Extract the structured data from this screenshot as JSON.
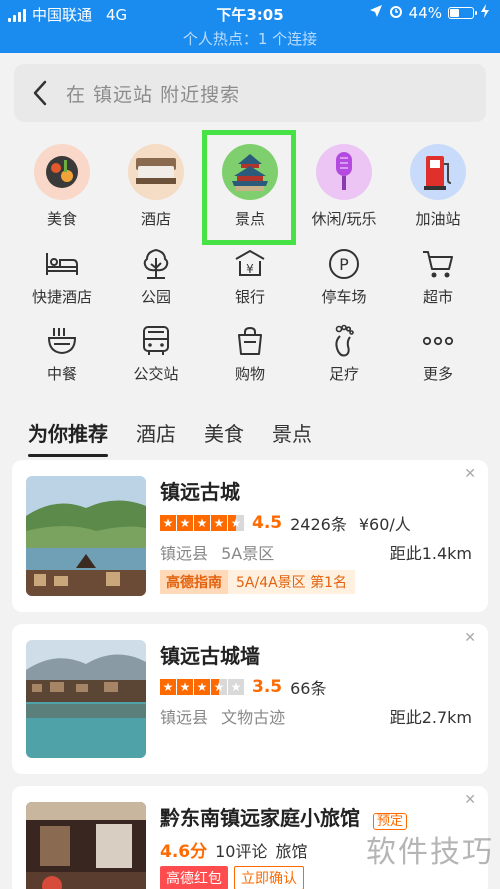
{
  "status": {
    "carrier": "中国联通",
    "network": "4G",
    "time": "下午3:05",
    "battery": "44%"
  },
  "hotspot": "个人热点：1 个连接",
  "search": {
    "placeholder": "在 镇远站 附近搜索"
  },
  "categories_top": [
    {
      "label": "美食",
      "icon": "food-icon",
      "color": "#f9d7c9"
    },
    {
      "label": "酒店",
      "icon": "hotel-bed-icon",
      "color": "#f5dcc5"
    },
    {
      "label": "景点",
      "icon": "temple-icon",
      "color": "#7fcf6e"
    },
    {
      "label": "休闲/玩乐",
      "icon": "microphone-icon",
      "color": "#ecc5f5"
    },
    {
      "label": "加油站",
      "icon": "gas-station-icon",
      "color": "#c9dbfa"
    }
  ],
  "categories_mid": [
    {
      "label": "快捷酒店",
      "icon": "bed-icon"
    },
    {
      "label": "公园",
      "icon": "tree-icon"
    },
    {
      "label": "银行",
      "icon": "bank-icon"
    },
    {
      "label": "停车场",
      "icon": "parking-icon"
    },
    {
      "label": "超市",
      "icon": "cart-icon"
    }
  ],
  "categories_bottom": [
    {
      "label": "中餐",
      "icon": "bowl-icon"
    },
    {
      "label": "公交站",
      "icon": "bus-icon"
    },
    {
      "label": "购物",
      "icon": "bag-icon"
    },
    {
      "label": "足疗",
      "icon": "foot-icon"
    },
    {
      "label": "更多",
      "icon": "more-icon"
    }
  ],
  "tabs": [
    "为你推荐",
    "酒店",
    "美食",
    "景点"
  ],
  "cards": [
    {
      "title": "镇远古城",
      "rating": 4.5,
      "rating_text": "4.5",
      "reviews": "2426条",
      "price": "¥60/人",
      "area": "镇远县",
      "type": "5A景区",
      "distance": "距此1.4km",
      "badge1": "高德指南",
      "badge2": "5A/4A景区 第1名"
    },
    {
      "title": "镇远古城墙",
      "rating": 3.5,
      "rating_text": "3.5",
      "reviews": "66条",
      "area": "镇远县",
      "type": "文物古迹",
      "distance": "距此2.7km"
    },
    {
      "title": "黔东南镇远家庭小旅馆",
      "tag": "预定",
      "score": "4.6分",
      "reviews": "10评论",
      "type": "旅馆",
      "badge1": "高德红包",
      "badge2": "立即确认"
    }
  ],
  "watermark": "软件技巧"
}
